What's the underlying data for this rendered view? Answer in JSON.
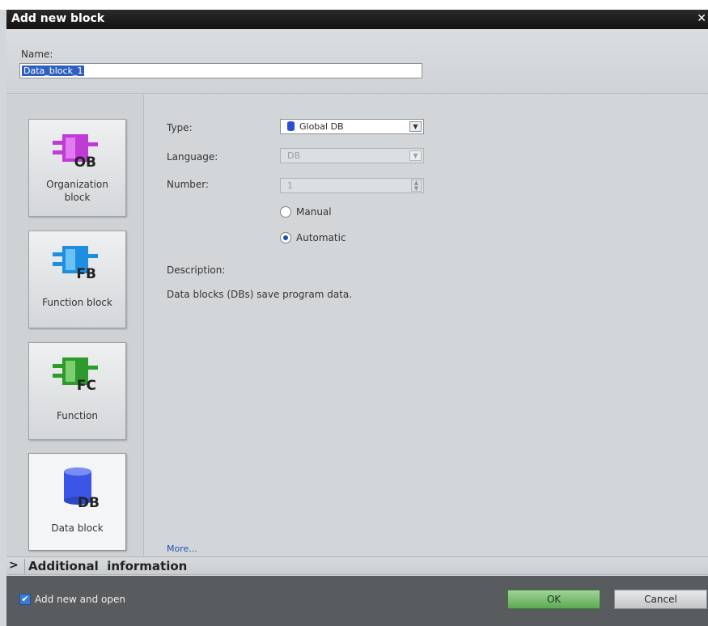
{
  "dialog": {
    "title": "Add new block",
    "close_glyph": "✕"
  },
  "name": {
    "label": "Name:",
    "value": "Data_block_1"
  },
  "blocks": [
    {
      "id": "ob",
      "icon": "organization-block-icon",
      "icon_text": "OB",
      "label": "Organization block",
      "color": "#c03ad6"
    },
    {
      "id": "fb",
      "icon": "function-block-icon",
      "icon_text": "FB",
      "label": "Function block",
      "color": "#1e8fe0"
    },
    {
      "id": "fc",
      "icon": "function-icon",
      "icon_text": "FC",
      "label": "Function",
      "color": "#2e9a2b"
    },
    {
      "id": "db",
      "icon": "data-block-icon",
      "icon_text": "DB",
      "label": "Data block",
      "color": "#3b55e6",
      "selected": true
    }
  ],
  "fields": {
    "type": {
      "label": "Type:",
      "value": "Global DB"
    },
    "language": {
      "label": "Language:",
      "value": "DB"
    },
    "number": {
      "label": "Number:",
      "value": "1"
    }
  },
  "radio": {
    "manual_label": "Manual",
    "automatic_label": "Automatic",
    "selected": "automatic"
  },
  "description": {
    "label": "Description:",
    "text": "Data blocks (DBs) save program data."
  },
  "more_link": "More...",
  "additional_info": {
    "chevron": ">",
    "label": "Additional  information"
  },
  "footer": {
    "add_open_label": "Add new and open",
    "add_open_checked": true,
    "ok_label": "OK",
    "cancel_label": "Cancel"
  }
}
